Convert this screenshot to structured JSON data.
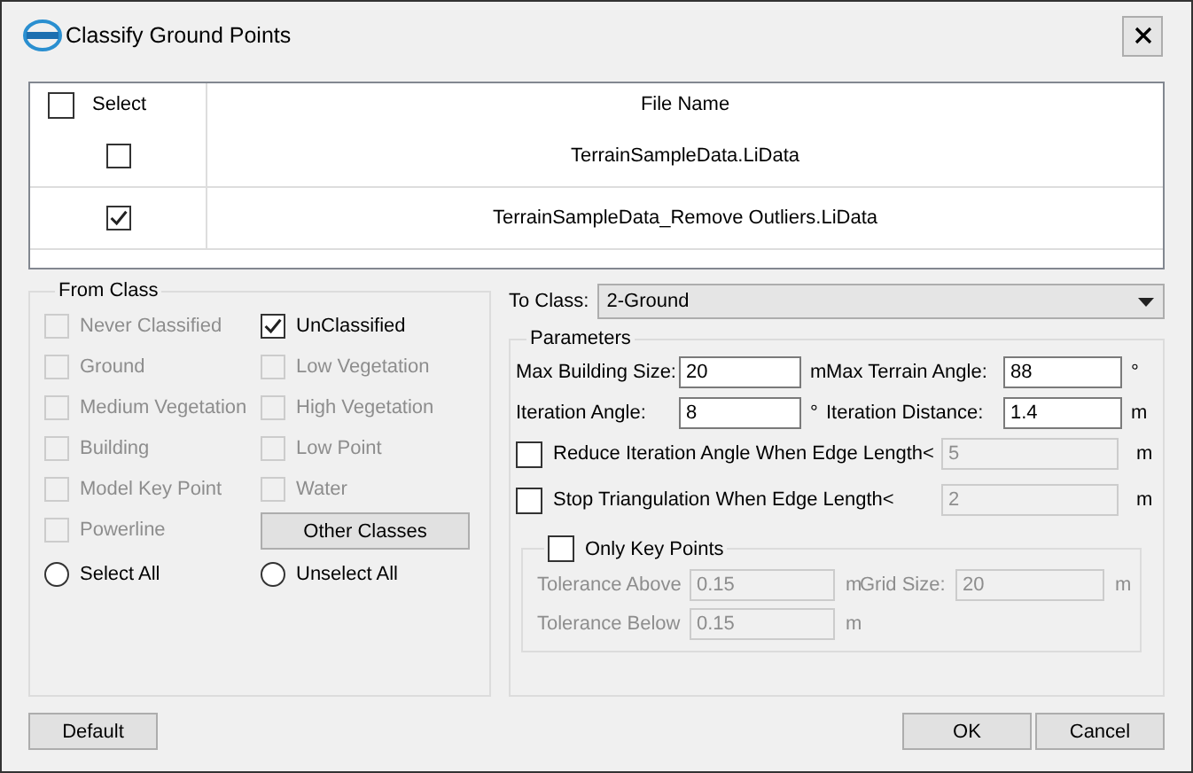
{
  "window": {
    "title": "Classify Ground Points"
  },
  "file_table": {
    "header_checked": false,
    "columns": [
      "Select",
      "File Name"
    ],
    "rows": [
      {
        "checked": false,
        "name": "TerrainSampleData.LiData"
      },
      {
        "checked": true,
        "name": "TerrainSampleData_Remove Outliers.LiData"
      }
    ]
  },
  "from_class": {
    "title": "From Class",
    "items": [
      {
        "label": "Never Classified",
        "checked": false,
        "disabled": true
      },
      {
        "label": "UnClassified",
        "checked": true,
        "disabled": false
      },
      {
        "label": "Ground",
        "checked": false,
        "disabled": true
      },
      {
        "label": "Low Vegetation",
        "checked": false,
        "disabled": true
      },
      {
        "label": "Medium Vegetation",
        "checked": false,
        "disabled": true
      },
      {
        "label": "High Vegetation",
        "checked": false,
        "disabled": true
      },
      {
        "label": "Building",
        "checked": false,
        "disabled": true
      },
      {
        "label": "Low Point",
        "checked": false,
        "disabled": true
      },
      {
        "label": "Model Key Point",
        "checked": false,
        "disabled": true
      },
      {
        "label": "Water",
        "checked": false,
        "disabled": true
      },
      {
        "label": "Powerline",
        "checked": false,
        "disabled": true
      }
    ],
    "other_button": "Other Classes",
    "radios": [
      {
        "label": "Select All",
        "selected": false
      },
      {
        "label": "Unselect All",
        "selected": false
      }
    ]
  },
  "to_class": {
    "label": "To Class:",
    "value": "2-Ground"
  },
  "parameters": {
    "title": "Parameters",
    "fields": [
      {
        "label": "Max Building Size:",
        "value": "20",
        "unit": "m"
      },
      {
        "label": "Max Terrain Angle:",
        "value": "88",
        "unit": "°"
      },
      {
        "label": "Iteration Angle:",
        "value": "8",
        "unit": "°"
      },
      {
        "label": "Iteration Distance:",
        "value": "1.4",
        "unit": "m"
      }
    ],
    "options": [
      {
        "label": "Reduce Iteration Angle When Edge Length<",
        "checked": false,
        "value": "5",
        "unit": "m"
      },
      {
        "label": "Stop Triangulation When Edge Length<",
        "checked": false,
        "value": "2",
        "unit": "m"
      }
    ],
    "key_points": {
      "label": "Only Key Points",
      "checked": false,
      "disabled": true,
      "fields": [
        {
          "label": "Tolerance Above",
          "value": "0.15",
          "unit": "m"
        },
        {
          "label": "Grid Size:",
          "value": "20",
          "unit": "m"
        },
        {
          "label": "Tolerance Below",
          "value": "0.15",
          "unit": "m"
        }
      ]
    }
  },
  "buttons": {
    "default": "Default",
    "ok": "OK",
    "cancel": "Cancel"
  }
}
